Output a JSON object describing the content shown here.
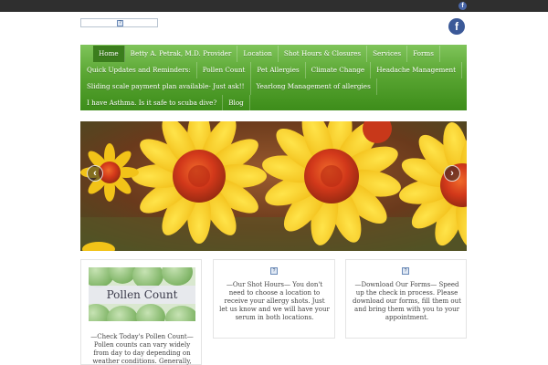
{
  "topbar": {
    "facebook_icon": "facebook-icon"
  },
  "header": {
    "logo_icon": "broken-image-icon",
    "facebook_icon": "facebook-icon"
  },
  "nav": {
    "rows": [
      [
        "Home",
        "Betty A. Petrak, M.D. Provider",
        "Location",
        "Shot Hours & Closures",
        "Services",
        "Forms"
      ],
      [
        "Quick Updates and Reminders:",
        "Pollen Count",
        "Pet Allergies",
        "Climate Change",
        "Headache Management"
      ],
      [
        "Sliding scale payment plan available- Just ask!!",
        "Yearlong Management of allergies"
      ],
      [
        "I have Asthma. Is it safe to scuba dive?",
        "Blog"
      ]
    ],
    "active": "Home"
  },
  "slider": {
    "prev_icon": "chevron-left-icon",
    "next_icon": "chevron-right-icon",
    "prev_label": "‹",
    "next_label": "›"
  },
  "cards": {
    "pollen": {
      "image_title": "Pollen Count",
      "text": "—Check Today's Pollen Count— Pollen counts can vary widely from day to day depending on weather conditions. Generally, pollen levels"
    },
    "shot_hours": {
      "icon": "broken-image-icon",
      "text": "—Our Shot Hours— You don't need to choose a location to receive your allergy shots. Just let us know and we will have your serum in both locations."
    },
    "forms": {
      "icon": "broken-image-icon",
      "text": "—Download Our Forms— Speed up the check in process. Please download our forms, fill them out and bring them with you to your appointment."
    }
  },
  "colors": {
    "topbar": "#2f2f2f",
    "nav_green": "#5aa633",
    "nav_active": "#3b7d1d",
    "facebook_blue": "#3b5998"
  }
}
